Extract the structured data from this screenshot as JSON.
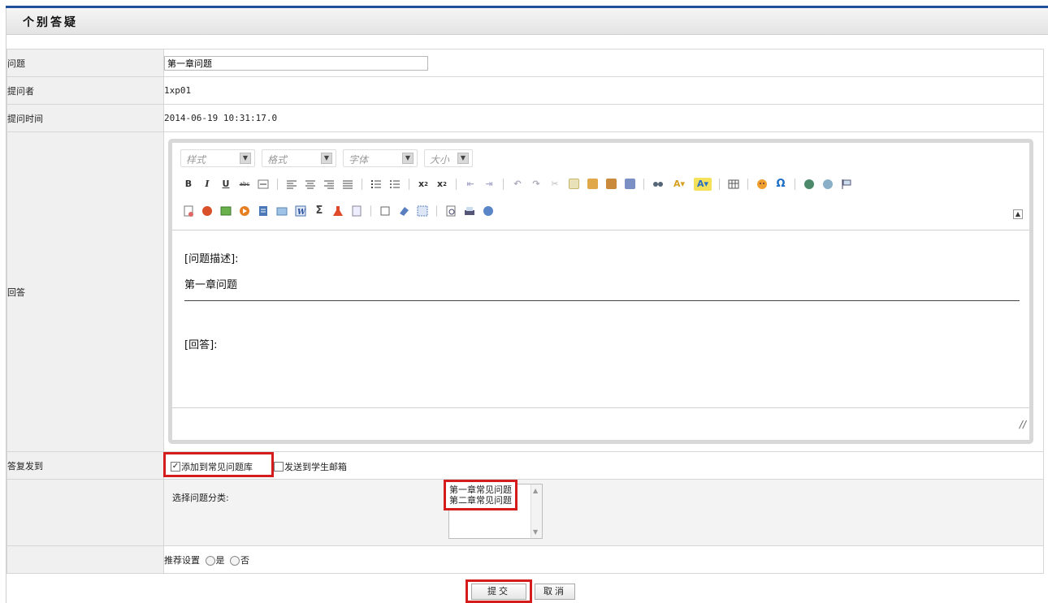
{
  "panel": {
    "title": "个别答疑"
  },
  "rows": {
    "question": {
      "label": "问题",
      "value": "第一章问题"
    },
    "asker": {
      "label": "提问者",
      "value": "1xp01"
    },
    "time": {
      "label": "提问时间",
      "value": "2014-06-19 10:31:17.0"
    },
    "answer": {
      "label": "回答"
    },
    "send_to": {
      "label": "答复发到"
    },
    "recommend": {
      "label": "推荐设置",
      "yes": "是",
      "no": "否"
    }
  },
  "editor": {
    "combos": [
      "样式",
      "格式",
      "字体",
      "大小"
    ],
    "body": {
      "line1": "[问题描述]:",
      "line2": "第一章问题",
      "line3": "[回答]:"
    }
  },
  "send_options": {
    "add_faq": {
      "label": "添加到常见问题库",
      "checked": true
    },
    "send_email": {
      "label": "发送到学生邮箱",
      "checked": false
    }
  },
  "category": {
    "label": "选择问题分类:",
    "options": [
      "第一章常见问题",
      "第二章常见问题"
    ]
  },
  "buttons": {
    "submit": "提交",
    "cancel": "取消"
  },
  "colors": {
    "highlight": "#d41c1c",
    "header_line": "#1e4f9a"
  }
}
